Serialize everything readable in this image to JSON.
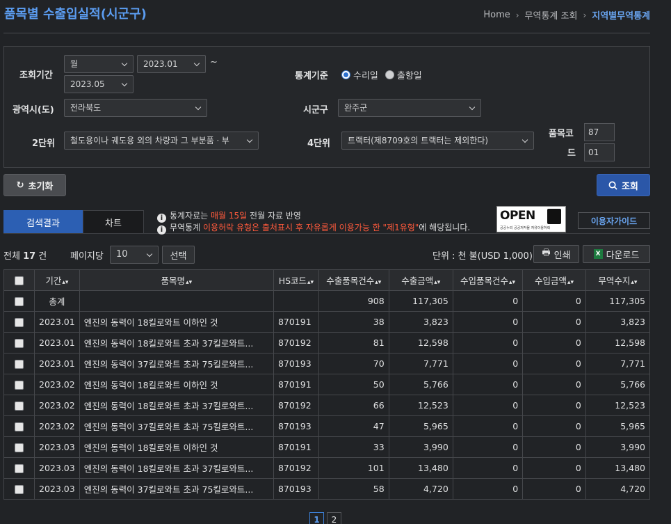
{
  "page_title": "품목별 수출입실적(시군구)",
  "breadcrumb": [
    "Home",
    "무역통계 조회",
    "지역별무역통계"
  ],
  "colors": {
    "accent": "#5b9cf0",
    "primary_button": "#2b57a8",
    "highlight": "#ff5a3c",
    "background": "#212326"
  },
  "filters": {
    "period_label": "조회기간",
    "period_unit": "월",
    "period_from": "2023.01",
    "period_sep": "~",
    "period_to": "2023.05",
    "basis_label": "통계기준",
    "basis_options": [
      "수리일",
      "출항일"
    ],
    "basis_selected": "수리일",
    "province_label": "광역시(도)",
    "province_value": "전라북도",
    "city_label": "시군구",
    "city_value": "완주군",
    "level2_label": "2단위",
    "level2_value": "철도용이나 궤도용 외의 차량과 그 부분품ㆍ부",
    "level4_label": "4단위",
    "level4_value": "트랙터(제8709호의 트랙터는 제외한다)",
    "code_label_1": "품목코",
    "code_label_2": "드",
    "code_value_1": "87",
    "code_value_2": "01"
  },
  "buttons": {
    "reset": "초기화",
    "search": "조회",
    "select": "선택",
    "print": "인쇄",
    "download": "다운로드",
    "guide": "이용자가이드"
  },
  "icons": {
    "reset": "refresh-icon",
    "search": "search-icon",
    "print": "printer-icon",
    "download": "excel-icon",
    "info": "info-icon"
  },
  "tabs": [
    "검색결과",
    "차트"
  ],
  "notice": {
    "line1_pre": "통계자료는 ",
    "line1_hl": "매월 15일",
    "line1_post": " 전월 자료 반영",
    "line2_pre": "무역통계 ",
    "line2_hl": "이용허락 유형은 출처표시 후 자유롭게 이용가능 한 \"제1유형\"",
    "line2_post": "에 해당됩니다."
  },
  "open_badge": {
    "text": "OPEN",
    "sub": "공공누리  공공저작물 자유이용허락"
  },
  "summary": {
    "prefix": "전체",
    "count": "17",
    "suffix": "건"
  },
  "per_page": {
    "label": "페이지당",
    "value": "10"
  },
  "unit": "단위 : 천 불(USD 1,000)",
  "table": {
    "headers": [
      "기간",
      "품목명",
      "HS코드",
      "수출품목건수",
      "수출금액",
      "수입품목건수",
      "수입금액",
      "무역수지"
    ],
    "rows": [
      [
        "총계",
        "",
        "",
        "908",
        "117,305",
        "0",
        "0",
        "117,305"
      ],
      [
        "2023.01",
        "엔진의 동력이 18킬로와트 이하인 것",
        "870191",
        "38",
        "3,823",
        "0",
        "0",
        "3,823"
      ],
      [
        "2023.01",
        "엔진의 동력이 18킬로와트 초과 37킬로와트...",
        "870192",
        "81",
        "12,598",
        "0",
        "0",
        "12,598"
      ],
      [
        "2023.01",
        "엔진의 동력이 37킬로와트 초과 75킬로와트...",
        "870193",
        "70",
        "7,771",
        "0",
        "0",
        "7,771"
      ],
      [
        "2023.02",
        "엔진의 동력이 18킬로와트 이하인 것",
        "870191",
        "50",
        "5,766",
        "0",
        "0",
        "5,766"
      ],
      [
        "2023.02",
        "엔진의 동력이 18킬로와트 초과 37킬로와트...",
        "870192",
        "66",
        "12,523",
        "0",
        "0",
        "12,523"
      ],
      [
        "2023.02",
        "엔진의 동력이 37킬로와트 초과 75킬로와트...",
        "870193",
        "47",
        "5,965",
        "0",
        "0",
        "5,965"
      ],
      [
        "2023.03",
        "엔진의 동력이 18킬로와트 이하인 것",
        "870191",
        "33",
        "3,990",
        "0",
        "0",
        "3,990"
      ],
      [
        "2023.03",
        "엔진의 동력이 18킬로와트 초과 37킬로와트...",
        "870192",
        "101",
        "13,480",
        "0",
        "0",
        "13,480"
      ],
      [
        "2023.03",
        "엔진의 동력이 37킬로와트 초과 75킬로와트...",
        "870193",
        "58",
        "4,720",
        "0",
        "0",
        "4,720"
      ]
    ]
  },
  "pagination": {
    "pages": [
      "1",
      "2"
    ],
    "current": "1"
  }
}
